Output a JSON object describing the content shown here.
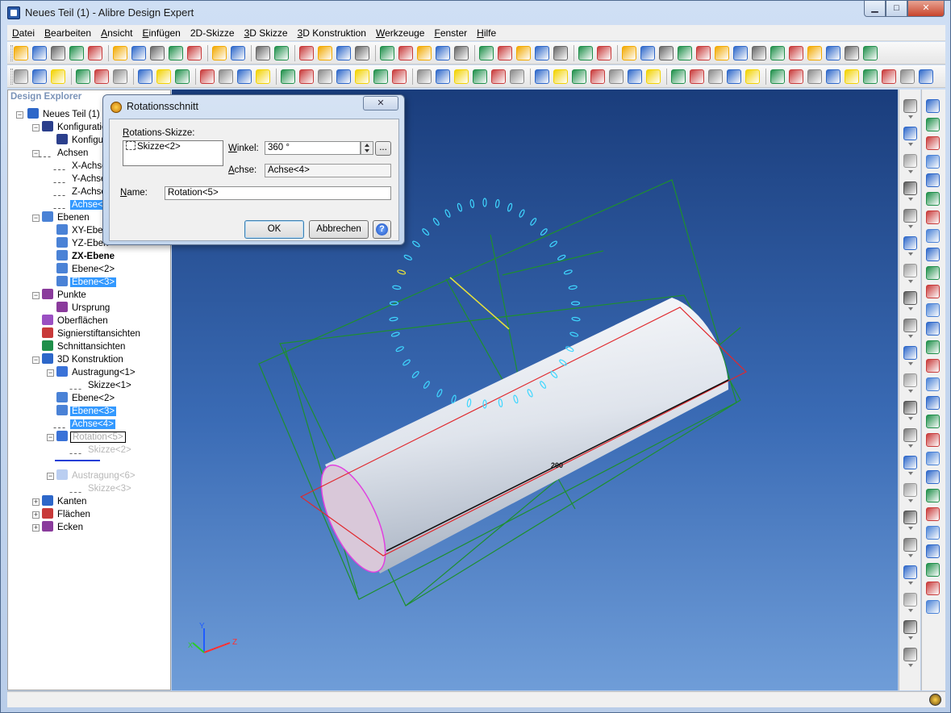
{
  "window": {
    "title": "Neues Teil (1) - Alibre Design Expert",
    "min_glyph": "▁",
    "max_glyph": "□",
    "close_glyph": "✕"
  },
  "menu": [
    {
      "key": "D",
      "rest": "atei"
    },
    {
      "key": "B",
      "rest": "earbeiten"
    },
    {
      "key": "A",
      "rest": "nsicht"
    },
    {
      "key": "E",
      "rest": "infügen"
    },
    {
      "key": "2",
      "rest": "D-Skizze"
    },
    {
      "key": "3",
      "rest": "D Skizze"
    },
    {
      "key": "3",
      "rest": "D Konstruktion"
    },
    {
      "key": "W",
      "rest": "erkzeuge"
    },
    {
      "key": "F",
      "rest": "enster"
    },
    {
      "key": "H",
      "rest": "ilfe"
    }
  ],
  "explorer": {
    "title": "Design Explorer",
    "items": [
      {
        "label": "Neues Teil (1)",
        "icon": "part-icon"
      },
      {
        "label": "Konfiguration",
        "icon": "configuration-icon"
      },
      {
        "label": "Konfigur",
        "icon": "configuration-icon"
      },
      {
        "label": "Achsen",
        "icon": "axis-icon"
      },
      {
        "label": "X-Achse",
        "icon": "axis-icon"
      },
      {
        "label": "Y-Achse",
        "icon": "axis-icon"
      },
      {
        "label": "Z-Achse",
        "icon": "axis-icon"
      },
      {
        "label": "Achse<4",
        "icon": "axis-icon"
      },
      {
        "label": "Ebenen",
        "icon": "plane-icon"
      },
      {
        "label": "XY-Eben",
        "icon": "plane-icon"
      },
      {
        "label": "YZ-Eben",
        "icon": "plane-icon"
      },
      {
        "label": "ZX-Ebene",
        "icon": "plane-icon"
      },
      {
        "label": "Ebene<2>",
        "icon": "plane-icon"
      },
      {
        "label": "Ebene<3>",
        "icon": "plane-icon"
      },
      {
        "label": "Punkte",
        "icon": "point-icon"
      },
      {
        "label": "Ursprung",
        "icon": "point-icon"
      },
      {
        "label": "Oberflächen",
        "icon": "surface-icon"
      },
      {
        "label": "Signierstiftansichten",
        "icon": "pen-icon"
      },
      {
        "label": "Schnittansichten",
        "icon": "section-icon"
      },
      {
        "label": "3D Konstruktion",
        "icon": "feature-icon"
      },
      {
        "label": "Austragung<1>",
        "icon": "extrude-icon"
      },
      {
        "label": "Skizze<1>",
        "icon": "sketch-icon"
      },
      {
        "label": "Ebene<2>",
        "icon": "plane-icon"
      },
      {
        "label": "Ebene<3>",
        "icon": "plane-icon"
      },
      {
        "label": "Achse<4>",
        "icon": "axis-icon"
      },
      {
        "label": "Rotation<5>",
        "icon": "revolve-icon"
      },
      {
        "label": "Skizze<2>",
        "icon": "sketch-icon"
      },
      {
        "label": "Austragung<6>",
        "icon": "extrude-icon"
      },
      {
        "label": "Skizze<3>",
        "icon": "sketch-icon"
      },
      {
        "label": "Kanten",
        "icon": "edge-icon"
      },
      {
        "label": "Flächen",
        "icon": "face-icon"
      },
      {
        "label": "Ecken",
        "icon": "vertex-icon"
      }
    ]
  },
  "dialog": {
    "title": "Rotationsschnitt",
    "close_glyph": "✕",
    "sketch_label": {
      "key": "R",
      "rest": "otations-Skizze:"
    },
    "sketch_item": "Skizze<2>",
    "angle_label": {
      "key": "W",
      "rest": "inkel:"
    },
    "angle_value": "360 °",
    "browse_label": "...",
    "axis_label": {
      "key": "A",
      "rest": "chse:"
    },
    "axis_value": "Achse<4>",
    "name_label": {
      "key": "N",
      "rest": "ame:"
    },
    "name_value": "Rotation<5>",
    "ok_label": "OK",
    "cancel_label": "Abbrechen",
    "help_glyph": "?"
  },
  "viewport": {
    "dimension_label": "200",
    "axis_y": "Y",
    "axis_x": "X",
    "axis_z": "Z"
  },
  "colors": {
    "viewport_top": "#1a3d7c",
    "viewport_bottom": "#6f9dd8",
    "sketch_cyan": "#3fd7ff",
    "plane_green": "#1e8f2e",
    "outline_red": "#e0282d",
    "selection_blue": "#3399ff"
  }
}
